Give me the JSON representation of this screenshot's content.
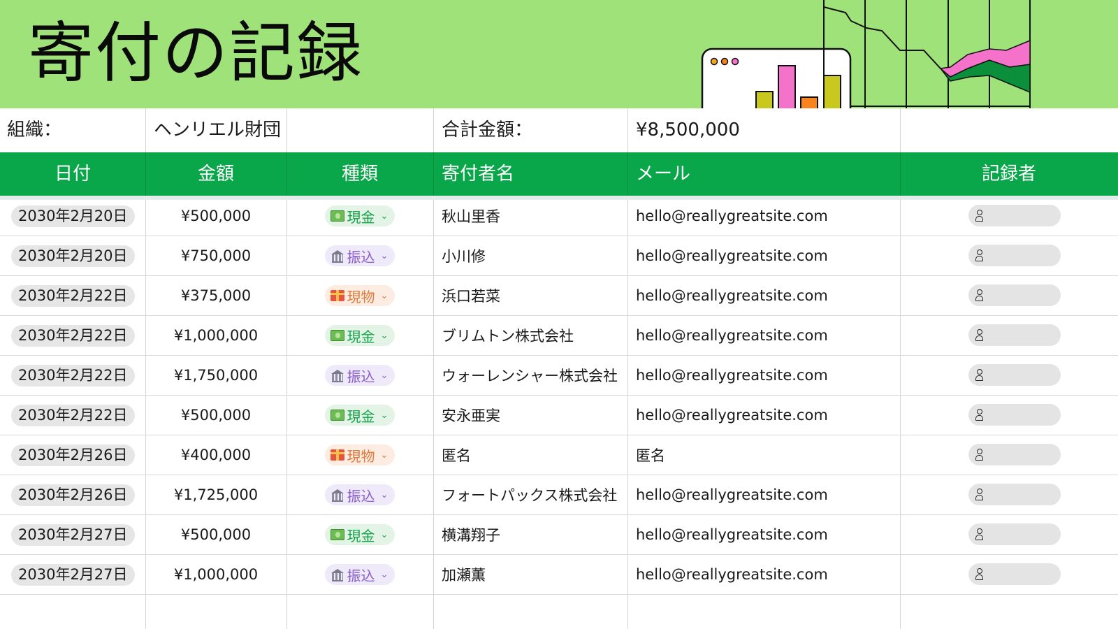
{
  "title": "寄付の記録",
  "info": {
    "org_label": "組織：",
    "org_value": "ヘンリエル財団",
    "total_label": "合計金額：",
    "total_value": "¥8,500,000"
  },
  "columns": {
    "date": "日付",
    "amount": "金額",
    "type": "種類",
    "donor": "寄付者名",
    "email": "メール",
    "recorder": "記録者"
  },
  "rows": [
    {
      "date": "2030年2月20日",
      "amount": "¥500,000",
      "type": "現金",
      "type_kind": "cash",
      "donor": "秋山里香",
      "email": "hello@reallygreatsite.com"
    },
    {
      "date": "2030年2月20日",
      "amount": "¥750,000",
      "type": "振込",
      "type_kind": "bank",
      "donor": "小川修",
      "email": "hello@reallygreatsite.com"
    },
    {
      "date": "2030年2月22日",
      "amount": "¥375,000",
      "type": "現物",
      "type_kind": "goods",
      "donor": "浜口若菜",
      "email": "hello@reallygreatsite.com"
    },
    {
      "date": "2030年2月22日",
      "amount": "¥1,000,000",
      "type": "現金",
      "type_kind": "cash",
      "donor": "ブリムトン株式会社",
      "email": "hello@reallygreatsite.com"
    },
    {
      "date": "2030年2月22日",
      "amount": "¥1,750,000",
      "type": "振込",
      "type_kind": "bank",
      "donor": "ウォーレンシャー株式会社",
      "email": "hello@reallygreatsite.com"
    },
    {
      "date": "2030年2月22日",
      "amount": "¥500,000",
      "type": "現金",
      "type_kind": "cash",
      "donor": "安永亜実",
      "email": "hello@reallygreatsite.com"
    },
    {
      "date": "2030年2月26日",
      "amount": "¥400,000",
      "type": "現物",
      "type_kind": "goods",
      "donor": "匿名",
      "email": "匿名"
    },
    {
      "date": "2030年2月26日",
      "amount": "¥1,725,000",
      "type": "振込",
      "type_kind": "bank",
      "donor": "フォートパックス株式会社",
      "email": "hello@reallygreatsite.com"
    },
    {
      "date": "2030年2月27日",
      "amount": "¥500,000",
      "type": "現金",
      "type_kind": "cash",
      "donor": "横溝翔子",
      "email": "hello@reallygreatsite.com"
    },
    {
      "date": "2030年2月27日",
      "amount": "¥1,000,000",
      "type": "振込",
      "type_kind": "bank",
      "donor": "加瀬薫",
      "email": "hello@reallygreatsite.com"
    }
  ],
  "icons": {
    "cash": "cash-icon",
    "bank": "bank-icon",
    "goods": "gift-icon",
    "recorder": "user-icon",
    "dropdown": "chevron-down-icon"
  },
  "colors": {
    "header_bg": "#a0e27a",
    "table_header_bg": "#0aa64a",
    "cash": "#16a34a",
    "bank": "#8b5cc7",
    "goods": "#e07a3a"
  }
}
